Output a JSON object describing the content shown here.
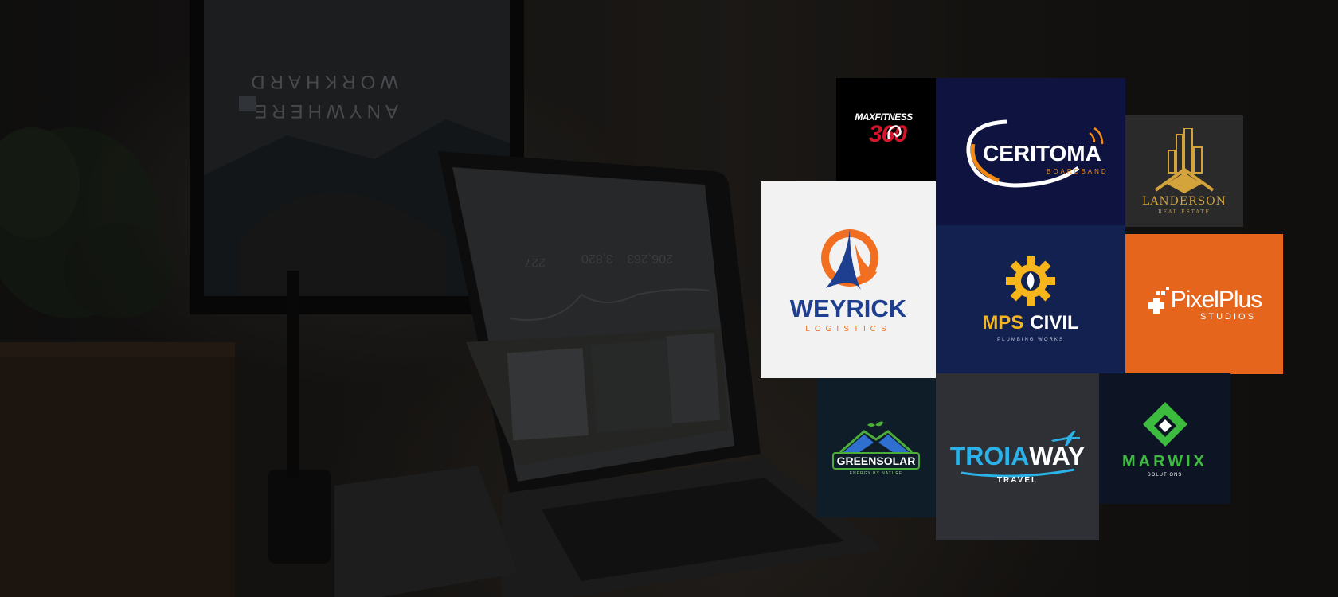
{
  "background": {
    "monitor_text_line1": "WORKHARD",
    "monitor_text_line2": "ANYWHERE",
    "laptop_stats": [
      "206,263",
      "3,820",
      "227"
    ]
  },
  "logos": {
    "maxfitness": {
      "line1": "MAXFITNESS",
      "line2": "360",
      "colors": {
        "bg": "#000000",
        "accent": "#d7142a"
      }
    },
    "ceritoma": {
      "name": "CERITOMA",
      "tagline": "BOARDBAND",
      "colors": {
        "bg": "#0e1340",
        "accent": "#f28a14"
      }
    },
    "landerson": {
      "name": "LANDERSON",
      "tagline": "REAL ESTATE",
      "colors": {
        "bg": "#2a2a2a",
        "accent": "#d3a33c"
      }
    },
    "weyrick": {
      "name": "WEYRICK",
      "tagline": "LOGISTICS",
      "colors": {
        "bg": "#f2f2f2",
        "primary": "#1e3f8f",
        "accent": "#f26f21"
      }
    },
    "mpscivil": {
      "name_a": "MPS",
      "name_b": "CIVIL",
      "tagline": "PLUMBING WORKS",
      "colors": {
        "bg": "#132150",
        "accent": "#f7b51c"
      }
    },
    "pixelplus": {
      "name": "PixelPlus",
      "tagline": "STUDIOS",
      "colors": {
        "bg": "#e5651d"
      }
    },
    "greensolar": {
      "name": "GREENSOLAR",
      "tagline": "ENERGY BY NATURE",
      "colors": {
        "bg": "#0e1d28",
        "accent": "#4cae3a"
      }
    },
    "troiaway": {
      "name_a": "TROIA",
      "name_b": "WAY",
      "tagline": "TRAVEL",
      "colors": {
        "bg": "#2e3036",
        "accent": "#2bb2e8"
      }
    },
    "marwix": {
      "name": "MARWIX",
      "tagline": "SOLUTIONS",
      "colors": {
        "bg": "#0d1424",
        "accent": "#3dbb3f"
      }
    }
  }
}
